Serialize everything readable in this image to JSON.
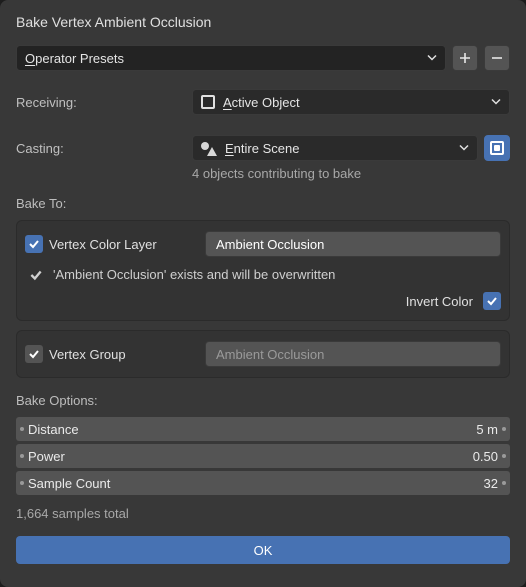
{
  "title": "Bake Vertex Ambient Occlusion",
  "presets": {
    "label": "Operator Presets",
    "mnemonic": "O"
  },
  "receiving": {
    "label": "Receiving:",
    "value": "Active Object",
    "mnemonic": "A"
  },
  "casting": {
    "label": "Casting:",
    "value": "Entire Scene",
    "mnemonic": "E",
    "note": "4 objects contributing to bake"
  },
  "bake_to": {
    "label": "Bake To:",
    "vcol": {
      "enabled": true,
      "label": "Vertex Color Layer",
      "value": "Ambient Occlusion",
      "exists_msg": "'Ambient Occlusion' exists and will be overwritten"
    },
    "invert": {
      "label": "Invert Color",
      "enabled": true
    },
    "vgroup": {
      "enabled": false,
      "label": "Vertex Group",
      "placeholder": "Ambient Occlusion"
    }
  },
  "options": {
    "label": "Bake Options:",
    "items": [
      {
        "name": "Distance",
        "value": "5 m"
      },
      {
        "name": "Power",
        "value": "0.50"
      },
      {
        "name": "Sample Count",
        "value": "32"
      }
    ],
    "summary": "1,664 samples total"
  },
  "ok": "OK"
}
